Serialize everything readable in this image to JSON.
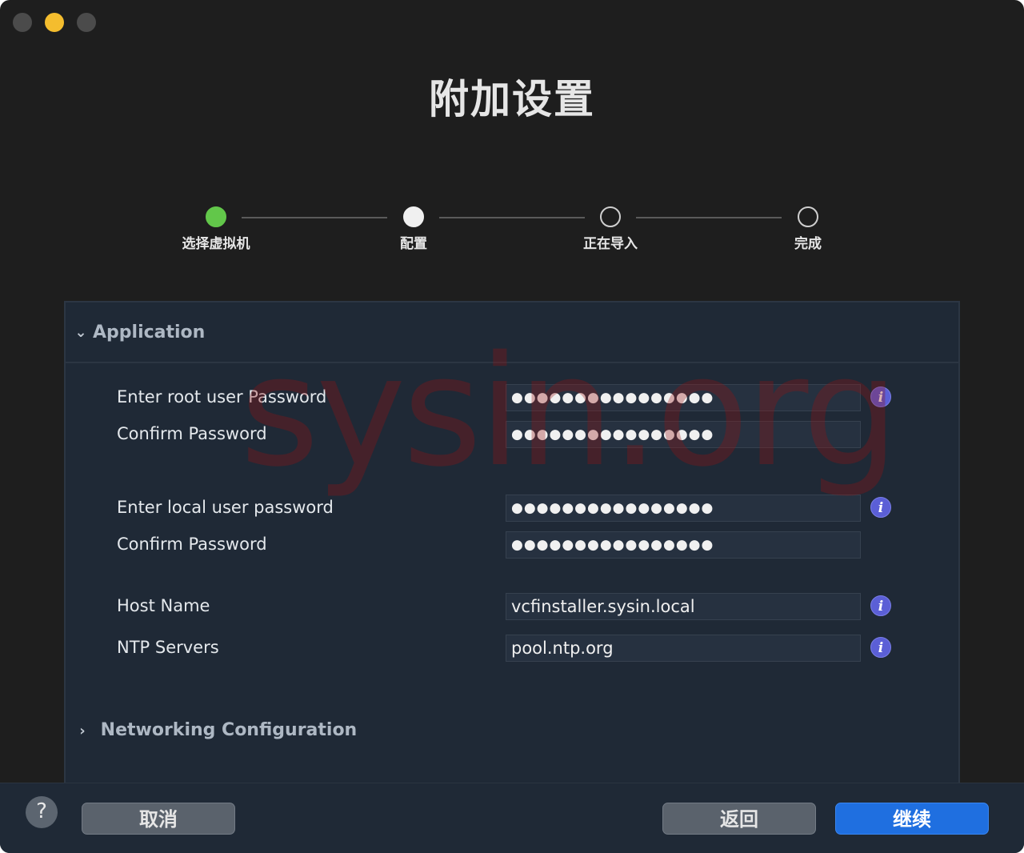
{
  "window": {
    "title": "附加设置"
  },
  "stepper": {
    "steps": [
      {
        "label": "选择虚拟机",
        "state": "done"
      },
      {
        "label": "配置",
        "state": "current"
      },
      {
        "label": "正在导入",
        "state": "pending"
      },
      {
        "label": "完成",
        "state": "pending"
      }
    ]
  },
  "application": {
    "header": "Application",
    "fields": [
      {
        "label": "Enter root user Password",
        "value": "●●●●●●●●●●●●●●●●",
        "info": true
      },
      {
        "label": "Confirm Password",
        "value": "●●●●●●●●●●●●●●●●",
        "info": false
      },
      {
        "label": "Enter local user password",
        "value": "●●●●●●●●●●●●●●●●",
        "info": true
      },
      {
        "label": "Confirm Password",
        "value": "●●●●●●●●●●●●●●●●",
        "info": false
      },
      {
        "label": "Host Name",
        "value": "vcfinstaller.sysin.local",
        "info": true
      },
      {
        "label": "NTP Servers",
        "value": "pool.ntp.org",
        "info": true
      }
    ]
  },
  "networking": {
    "header": "Networking Configuration"
  },
  "info_glyph": "i",
  "watermark": "sysin.org",
  "footer": {
    "help": "?",
    "cancel": "取消",
    "back": "返回",
    "continue": "继续"
  },
  "colors": {
    "accent": "#1f6fe0",
    "step_done": "#62c74a",
    "info": "#5b5fd6"
  }
}
